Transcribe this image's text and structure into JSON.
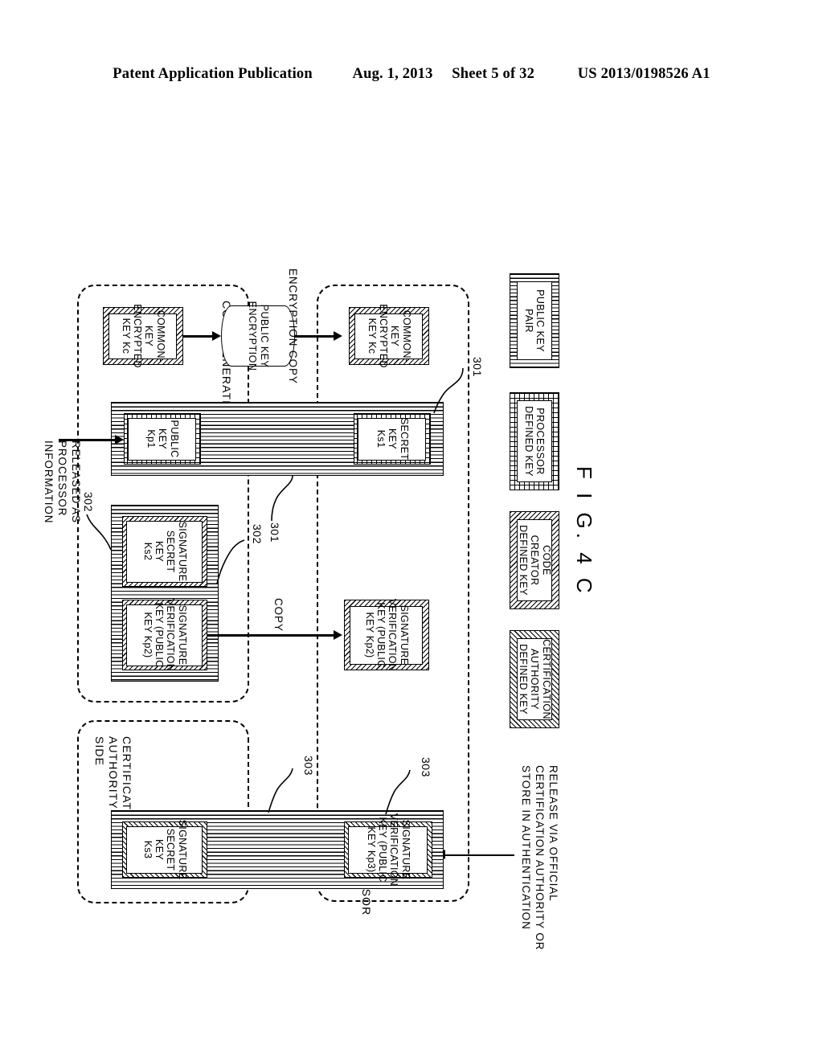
{
  "header": {
    "publication": "Patent Application Publication",
    "date": "Aug. 1, 2013",
    "sheet": "Sheet 5 of 32",
    "patent_number": "US 2013/0198526 A1"
  },
  "figure": {
    "caption": "F I G.  4 C"
  },
  "legend": [
    {
      "label": "PUBLIC KEY\nPAIR",
      "pattern": "vertical-stripes"
    },
    {
      "label": "PROCESSOR\nDEFINED KEY",
      "pattern": "cross-grid"
    },
    {
      "label": "CODE CREATOR\nDEFINED KEY",
      "pattern": "diagonal-hatch"
    },
    {
      "label": "CERTIFICATION\nAUTHORITY\nDEFINED KEY",
      "pattern": "diagonal-hatch-reverse"
    }
  ],
  "groups": {
    "processor_side": "PROCESSOR\nSIDE",
    "code_generation_side": "CODE GENERATION SIDE",
    "certification_authority_side": "CERTIFICATION AUTHORITY\nSIDE"
  },
  "callouts": {
    "release_note": "RELEASE VIA OFFICIAL\nCERTIFICATION AUTHORITY OR\nSTORE IN AUTHENTICATION",
    "encryption_copy": "ENCRYPTION COPY",
    "copy": "COPY",
    "released_as_processor_information": "RELEASED AS\nPROCESSOR\nINFORMATION"
  },
  "nodes": {
    "public_key_encryption": "PUBLIC KEY\nENCRYPTION"
  },
  "keys": {
    "common_key_encrypted_top": "COMMON-KEY\nENCRYPTED\nKEY Kc",
    "common_key_encrypted_bottom": "COMMON-KEY\nENCRYPTED\nKEY Kc",
    "secret_key_ks1": "SECRET KEY\nKs1",
    "public_key_kp1": "PUBLIC KEY\nKp1",
    "sig_verification_kp2_top": "SIGNATURE\nVERIFICATION\nKEY (PUBLIC\nKEY Kp2)",
    "sig_verification_kp2_bottom": "SIGNATURE\nVERIFICATION\nKEY (PUBLIC\nKEY Kp2)",
    "sig_verification_kp3": "SIGNATURE\nVERIFICATION\nKEY (PUBLIC\nKEY Kp3)",
    "sig_secret_key_ks2": "SIGNATURE\nSECRET KEY\nKs2",
    "sig_secret_key_ks3": "SIGNATURE\nSECRET KEY\nKs3"
  },
  "reference_numerals": {
    "n301_top": "301",
    "n301_mid": "301",
    "n302_top": "302",
    "n302_bottom": "302",
    "n303_top": "303",
    "n303_mid": "303"
  }
}
